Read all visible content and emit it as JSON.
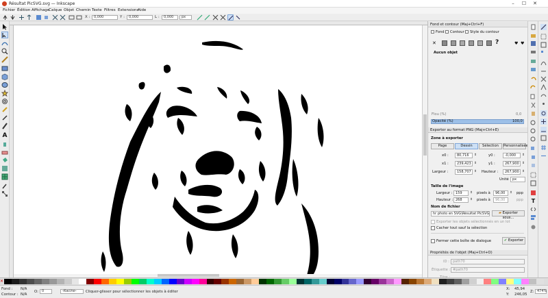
{
  "window": {
    "title": "Résultat PicSVG.svg — Inkscape"
  },
  "menu": [
    "Fichier",
    "Édition",
    "Affichage",
    "Calque",
    "Objet",
    "Chemin",
    "Texte",
    "Filtres",
    "Extensions",
    "Aide"
  ],
  "toolctrl": {
    "x_label": "X :",
    "x_value": "0,000",
    "y_label": "Y :",
    "y_value": "0,000",
    "w_label": "L :",
    "w_value": "0,000",
    "h_label": "H :",
    "h_value": "0,000",
    "unit": "px"
  },
  "fill_stroke": {
    "header": "Fond et contour (Maj+Ctrl+F)",
    "tab_fill": "Fond",
    "tab_stroke": "Contour",
    "tab_style": "Style du contour",
    "none_label": "Aucun objet",
    "blur_label": "Flou (%)",
    "blur_value": "0,0",
    "opacity_label": "Opacité (%)",
    "opacity_value": "100,0"
  },
  "export": {
    "header": "Exporter au format PNG (Maj+Ctrl+E)",
    "area_title": "Zone à exporter",
    "area_buttons": [
      "Page",
      "Dessin",
      "Sélection",
      "Personnalisée"
    ],
    "x0_label": "x0 :",
    "x0_value": "80,716",
    "y0_label": "y0 :",
    "y0_value": "-0,000",
    "x1_label": "x1 :",
    "x1_value": "239,423",
    "y1_label": "y1 :",
    "y1_value": "267,900",
    "width_label": "Largeur :",
    "width_value": "158,707",
    "height_label": "Hauteur :",
    "height_value": "267,900",
    "unit_label": "Unité :",
    "unit_value": "px",
    "image_title": "Taille de l'image",
    "img_width_label": "Largeur :",
    "img_width_value": "159",
    "img_height_label": "Hauteur :",
    "img_height_value": "268",
    "pixels_at": "pixels à",
    "dpi1": "96,00",
    "dpi2": "96,00",
    "ppp": "ppp",
    "file_title": "Nom de fichier",
    "file_value": "hr photo en SVG\\Résultat PicSVG.png",
    "export_as": "Exporter sous...",
    "opt1": "Exporter les objets sélectionnés en un lot",
    "opt2": "Cacher tout sauf la sélection",
    "close_dialog": "Fermer cette boîte de dialogue",
    "export_button": "Exporter"
  },
  "object_props": {
    "header": "Propriétés de l'objet (Maj+Ctrl+O)",
    "id_label": "ID :",
    "id_value": "path70",
    "label_label": "Étiquette :",
    "label_value": "#path70",
    "title_label": "Titre :"
  },
  "status": {
    "fill_label": "Fond :",
    "fill_value": "N/A",
    "stroke_label": "Contour :",
    "stroke_value": "N/A",
    "opacity_label": "O:",
    "opacity_value": "0",
    "layer": "-Racine-",
    "message": "Cliquer-glisser pour sélectionner les objets à éditer",
    "x_label": "X:",
    "x_value": "45,94",
    "y_label": "Y:",
    "y_value": "246,05",
    "zoom_label": "Z:",
    "zoom_value": "474%"
  },
  "palette_colors": [
    "#000000",
    "#1a1a1a",
    "#333333",
    "#4d4d4d",
    "#666666",
    "#808080",
    "#999999",
    "#b3b3b3",
    "#cccccc",
    "#e6e6e6",
    "#ffffff",
    "#800000",
    "#ff0000",
    "#ff6600",
    "#ffcc00",
    "#ffff00",
    "#99cc00",
    "#00ff00",
    "#00cc66",
    "#00ffcc",
    "#00ccff",
    "#0066ff",
    "#0000ff",
    "#6600cc",
    "#cc00ff",
    "#ff00ff",
    "#ff0099",
    "#330000",
    "#660000",
    "#993300",
    "#cc6600",
    "#996633",
    "#cc9966",
    "#ffcc99",
    "#003300",
    "#006600",
    "#339933",
    "#66cc66",
    "#99ff99",
    "#003333",
    "#006666",
    "#339999",
    "#66cccc",
    "#000033",
    "#000066",
    "#333399",
    "#6666cc",
    "#9999ff",
    "#330033",
    "#660066",
    "#993399",
    "#cc66cc",
    "#ff99ff",
    "#552200",
    "#884400",
    "#bb7733",
    "#ddaa77",
    "#f0e0c0",
    "#202020",
    "#404040",
    "#606060",
    "#a0a0a0",
    "#d0d0d0",
    "#f0f0f0",
    "#ff8080",
    "#80ff80",
    "#8080ff",
    "#ffff80",
    "#80ffff",
    "#ff80ff",
    "#c0c0c0",
    "#e0e0e0"
  ]
}
